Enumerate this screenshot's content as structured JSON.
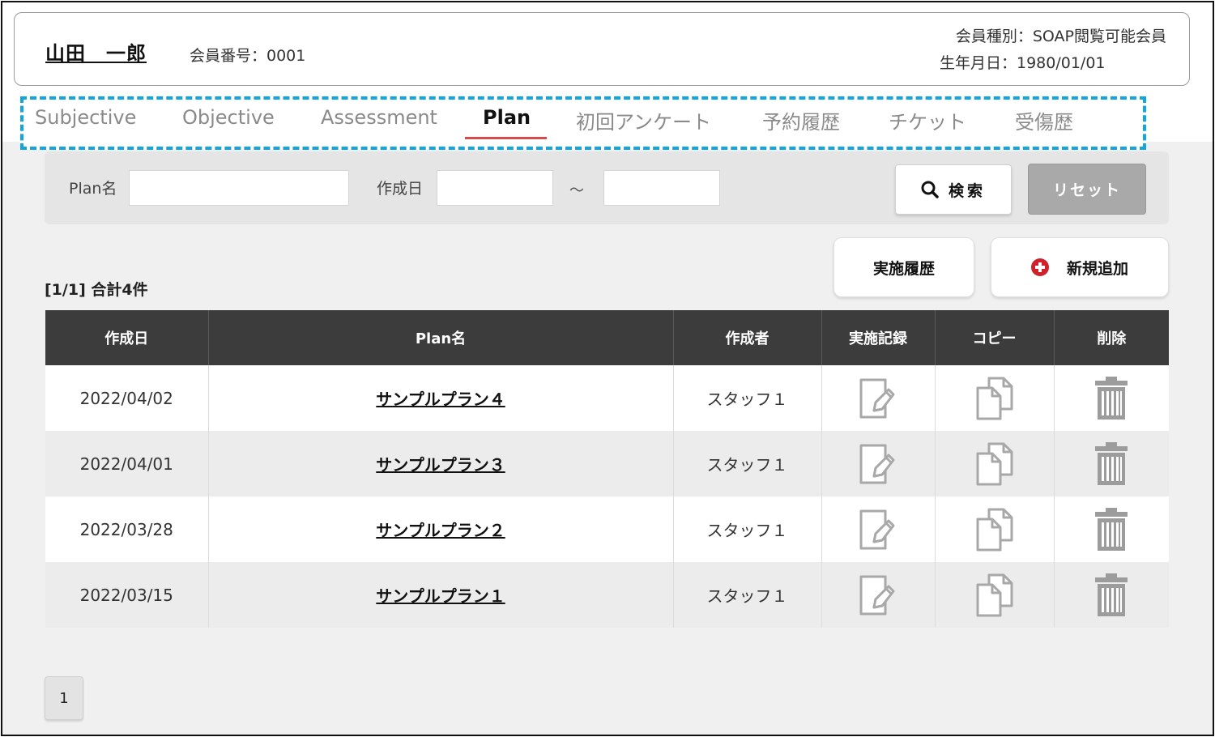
{
  "member": {
    "name": "山田　一郎",
    "number": "会員番号：0001",
    "type": "会員種別：SOAP閲覧可能会員",
    "birthdate": "生年月日：1980/01/01"
  },
  "tabs": [
    {
      "label": "Subjective",
      "active": false
    },
    {
      "label": "Objective",
      "active": false
    },
    {
      "label": "Assessment",
      "active": false
    },
    {
      "label": "Plan",
      "active": true
    },
    {
      "label": "初回アンケート",
      "active": false
    },
    {
      "label": "予約履歴",
      "active": false
    },
    {
      "label": "チケット",
      "active": false
    },
    {
      "label": "受傷歴",
      "active": false
    }
  ],
  "search": {
    "plan_name_label": "Plan名",
    "plan_name_value": "",
    "created_label": "作成日",
    "date_from": "",
    "date_to": "",
    "tilde": "～",
    "search_button": "検索",
    "reset_button": "リセット"
  },
  "actions": {
    "history_button": "実施履歴",
    "add_button": "新規追加"
  },
  "count_text": "[1/1] 合計4件",
  "table": {
    "headers": [
      "作成日",
      "Plan名",
      "作成者",
      "実施記録",
      "コピー",
      "削除"
    ],
    "rows": [
      {
        "date": "2022/04/02",
        "plan": "サンプルプラン４",
        "author": "スタッフ１"
      },
      {
        "date": "2022/04/01",
        "plan": "サンプルプラン３",
        "author": "スタッフ１"
      },
      {
        "date": "2022/03/28",
        "plan": "サンプルプラン２",
        "author": "スタッフ１"
      },
      {
        "date": "2022/03/15",
        "plan": "サンプルプラン１",
        "author": "スタッフ１"
      }
    ]
  },
  "pagination": {
    "current": "1"
  },
  "icons": {
    "search": "search-icon",
    "add": "plus-circle-icon",
    "record": "edit-note-icon",
    "copy": "copy-icon",
    "delete": "trash-icon"
  },
  "colors": {
    "tab_highlight_border": "#12a6e0",
    "active_tab_underline": "#d94a4a",
    "table_header_bg": "#3c3c3c",
    "add_icon": "#d0202a",
    "reset_button_bg": "#a9a9a9"
  }
}
